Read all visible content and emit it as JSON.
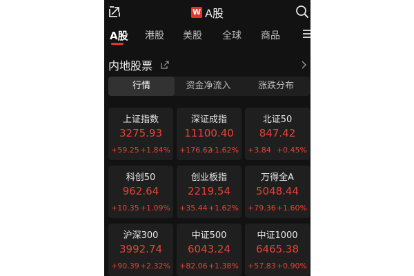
{
  "header": {
    "title": "A股",
    "logo_text": "W"
  },
  "tabs": [
    {
      "label": "A股",
      "active": true
    },
    {
      "label": "港股"
    },
    {
      "label": "美股"
    },
    {
      "label": "全球"
    },
    {
      "label": "商品"
    }
  ],
  "section": {
    "title": "内地股票"
  },
  "segments": [
    {
      "label": "行情",
      "active": true
    },
    {
      "label": "资金净流入"
    },
    {
      "label": "涨跌分布"
    }
  ],
  "cards": [
    {
      "name": "上证指数",
      "price": "3275.93",
      "change": "+59.25",
      "pct": "+1.84%"
    },
    {
      "name": "深证成指",
      "price": "11100.40",
      "change": "+176.62",
      "pct": "+1.62%"
    },
    {
      "name": "北证50",
      "price": "847.42",
      "change": "+3.84",
      "pct": "+0.45%"
    },
    {
      "name": "科创50",
      "price": "962.64",
      "change": "+10.35",
      "pct": "+1.09%"
    },
    {
      "name": "创业板指",
      "price": "2219.54",
      "change": "+35.44",
      "pct": "+1.62%"
    },
    {
      "name": "万得全A",
      "price": "5048.44",
      "change": "+79.36",
      "pct": "+1.60%"
    },
    {
      "name": "沪深300",
      "price": "3992.74",
      "change": "+90.39",
      "pct": "+2.32%"
    },
    {
      "name": "中证500",
      "price": "6043.24",
      "change": "+82.06",
      "pct": "+1.38%"
    },
    {
      "name": "中证1000",
      "price": "6465.38",
      "change": "+57.83",
      "pct": "+0.90%"
    }
  ],
  "colors": {
    "background": "#121212",
    "card": "#1f1f1f",
    "up": "#e84338",
    "accent": "#e0352b"
  },
  "icons": {
    "top_left": "external-link-icon",
    "search": "search-icon",
    "menu": "menu-icon",
    "share": "share-icon",
    "chevron": "chevron-right-icon"
  }
}
